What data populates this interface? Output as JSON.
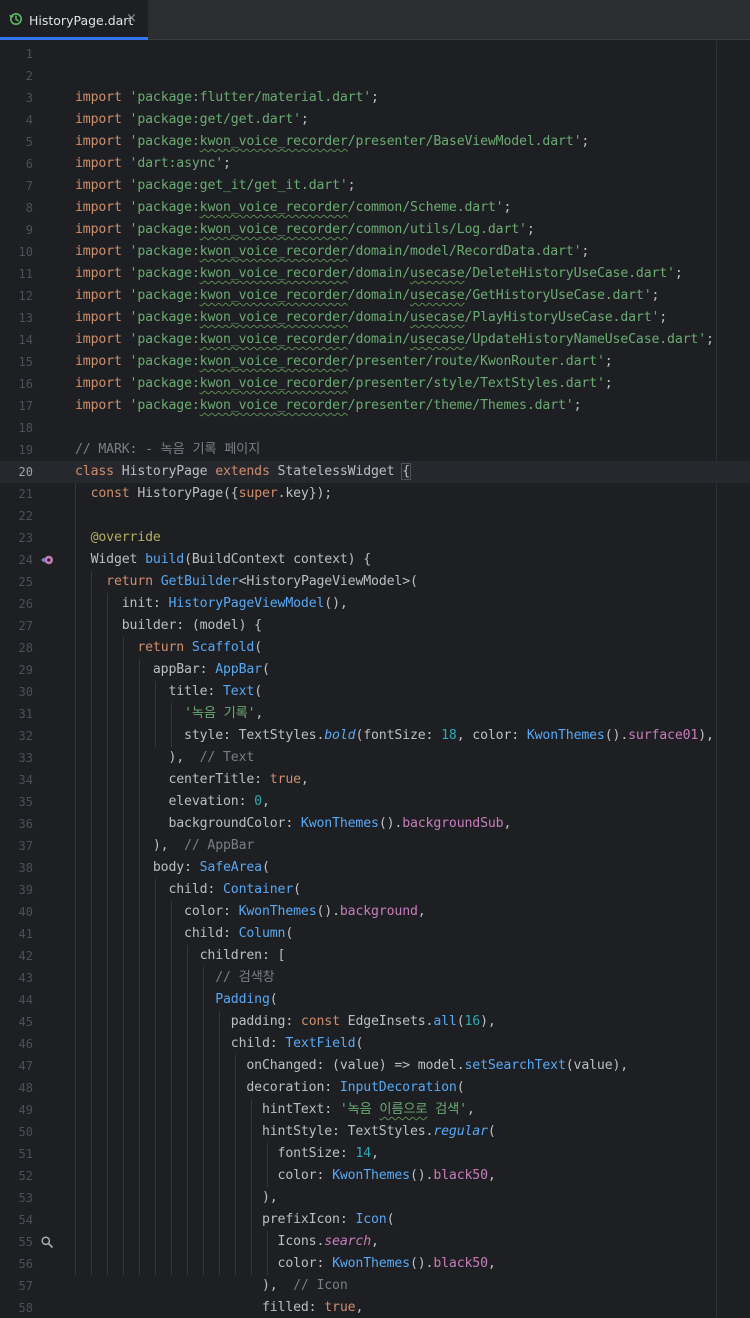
{
  "tab": {
    "icon": "history-file-icon",
    "title": "HistoryPage.dart",
    "close": "×"
  },
  "editor": {
    "current_line": 20,
    "gutter_icons": [
      {
        "line": 24,
        "icon": "override-method-icon"
      },
      {
        "line": 55,
        "icon": "search-icon"
      }
    ],
    "lines": [
      {
        "n": "1",
        "code": ""
      },
      {
        "n": "2",
        "code": ""
      },
      {
        "n": "3",
        "code": "import 'package:flutter/material.dart';"
      },
      {
        "n": "4",
        "code": "import 'package:get/get.dart';"
      },
      {
        "n": "5",
        "code": "import 'package:kwon_voice_recorder/presenter/BaseViewModel.dart';"
      },
      {
        "n": "6",
        "code": "import 'dart:async';"
      },
      {
        "n": "7",
        "code": "import 'package:get_it/get_it.dart';"
      },
      {
        "n": "8",
        "code": "import 'package:kwon_voice_recorder/common/Scheme.dart';"
      },
      {
        "n": "9",
        "code": "import 'package:kwon_voice_recorder/common/utils/Log.dart';"
      },
      {
        "n": "10",
        "code": "import 'package:kwon_voice_recorder/domain/model/RecordData.dart';"
      },
      {
        "n": "11",
        "code": "import 'package:kwon_voice_recorder/domain/usecase/DeleteHistoryUseCase.dart';"
      },
      {
        "n": "12",
        "code": "import 'package:kwon_voice_recorder/domain/usecase/GetHistoryUseCase.dart';"
      },
      {
        "n": "13",
        "code": "import 'package:kwon_voice_recorder/domain/usecase/PlayHistoryUseCase.dart';"
      },
      {
        "n": "14",
        "code": "import 'package:kwon_voice_recorder/domain/usecase/UpdateHistoryNameUseCase.dart';"
      },
      {
        "n": "15",
        "code": "import 'package:kwon_voice_recorder/presenter/route/KwonRouter.dart';"
      },
      {
        "n": "16",
        "code": "import 'package:kwon_voice_recorder/presenter/style/TextStyles.dart';"
      },
      {
        "n": "17",
        "code": "import 'package:kwon_voice_recorder/presenter/theme/Themes.dart';"
      },
      {
        "n": "18",
        "code": ""
      },
      {
        "n": "19",
        "code": "// MARK: - 녹음 기록 페이지"
      },
      {
        "n": "20",
        "code": "class HistoryPage extends StatelessWidget {"
      },
      {
        "n": "21",
        "code": "  const HistoryPage({super.key});"
      },
      {
        "n": "22",
        "code": ""
      },
      {
        "n": "23",
        "code": "  @override"
      },
      {
        "n": "24",
        "code": "  Widget build(BuildContext context) {"
      },
      {
        "n": "25",
        "code": "    return GetBuilder<HistoryPageViewModel>("
      },
      {
        "n": "26",
        "code": "      init: HistoryPageViewModel(),"
      },
      {
        "n": "27",
        "code": "      builder: (model) {"
      },
      {
        "n": "28",
        "code": "        return Scaffold("
      },
      {
        "n": "29",
        "code": "          appBar: AppBar("
      },
      {
        "n": "30",
        "code": "            title: Text("
      },
      {
        "n": "31",
        "code": "              '녹음 기록',"
      },
      {
        "n": "32",
        "code": "              style: TextStyles.bold(fontSize: 18, color: KwonThemes().surface01),"
      },
      {
        "n": "33",
        "code": "            ),  // Text"
      },
      {
        "n": "34",
        "code": "            centerTitle: true,"
      },
      {
        "n": "35",
        "code": "            elevation: 0,"
      },
      {
        "n": "36",
        "code": "            backgroundColor: KwonThemes().backgroundSub,"
      },
      {
        "n": "37",
        "code": "          ),  // AppBar"
      },
      {
        "n": "38",
        "code": "          body: SafeArea("
      },
      {
        "n": "39",
        "code": "            child: Container("
      },
      {
        "n": "40",
        "code": "              color: KwonThemes().background,"
      },
      {
        "n": "41",
        "code": "              child: Column("
      },
      {
        "n": "42",
        "code": "                children: ["
      },
      {
        "n": "43",
        "code": "                  // 검색창"
      },
      {
        "n": "44",
        "code": "                  Padding("
      },
      {
        "n": "45",
        "code": "                    padding: const EdgeInsets.all(16),"
      },
      {
        "n": "46",
        "code": "                    child: TextField("
      },
      {
        "n": "47",
        "code": "                      onChanged: (value) => model.setSearchText(value),"
      },
      {
        "n": "48",
        "code": "                      decoration: InputDecoration("
      },
      {
        "n": "49",
        "code": "                        hintText: '녹음 이름으로 검색',"
      },
      {
        "n": "50",
        "code": "                        hintStyle: TextStyles.regular("
      },
      {
        "n": "51",
        "code": "                          fontSize: 14,"
      },
      {
        "n": "52",
        "code": "                          color: KwonThemes().black50,"
      },
      {
        "n": "53",
        "code": "                        ),"
      },
      {
        "n": "54",
        "code": "                        prefixIcon: Icon("
      },
      {
        "n": "55",
        "code": "                          Icons.search,"
      },
      {
        "n": "56",
        "code": "                          color: KwonThemes().black50,"
      },
      {
        "n": "57",
        "code": "                        ),  // Icon"
      },
      {
        "n": "58",
        "code": "                        filled: true,"
      }
    ]
  }
}
